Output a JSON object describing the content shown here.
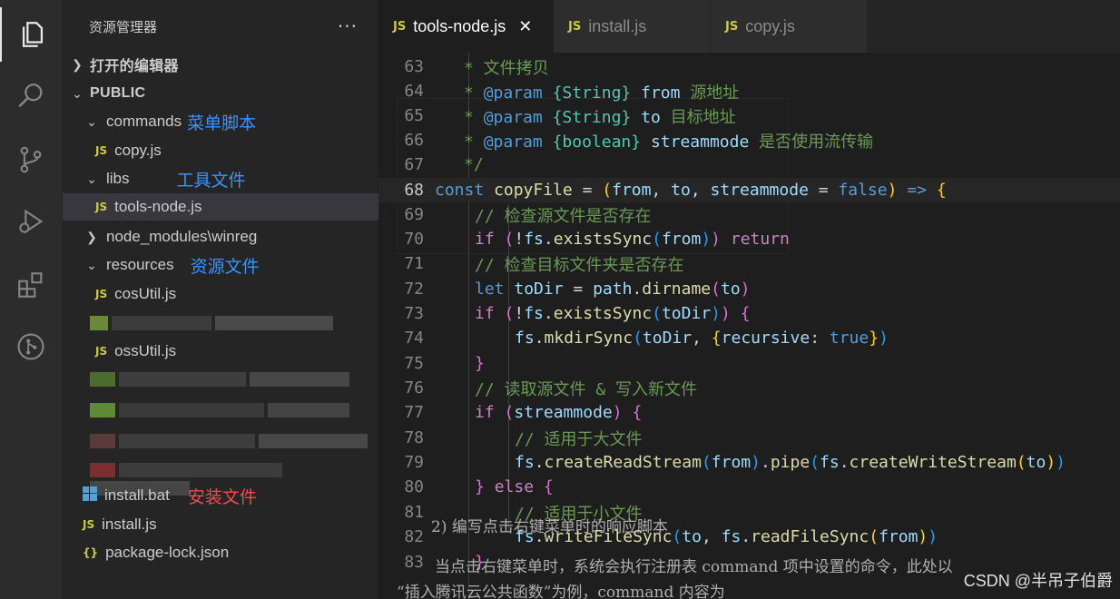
{
  "sidebar": {
    "title": "资源管理器",
    "more": "···",
    "open_editors": "打开的编辑器",
    "root": "PUBLIC",
    "items": [
      {
        "label": "commands",
        "note": "菜单脚本"
      },
      {
        "label": "copy.js"
      },
      {
        "label": "libs",
        "note": "工具文件"
      },
      {
        "label": "tools-node.js"
      },
      {
        "label": "node_modules\\winreg"
      },
      {
        "label": "resources",
        "note": "资源文件"
      },
      {
        "label": "cosUtil.js"
      },
      {
        "label": "ossUtil.js"
      },
      {
        "label": "install.bat",
        "note": "安装文件"
      },
      {
        "label": "install.js"
      },
      {
        "label": "package-lock.json"
      }
    ],
    "js_badge": "JS",
    "json_badge": "{}"
  },
  "tabs": [
    {
      "label": "tools-node.js",
      "close": "✕"
    },
    {
      "label": "install.js"
    },
    {
      "label": "copy.js"
    }
  ],
  "code": {
    "lines": [
      63,
      64,
      65,
      66,
      67,
      68,
      69,
      70,
      71,
      72,
      73,
      74,
      75,
      76,
      77,
      78,
      79,
      80,
      81,
      82,
      83
    ],
    "l63": "* 文件拷贝",
    "l64_param": "@param",
    "l64_type": "{String}",
    "l64_name": "from",
    "l64_desc": "源地址",
    "l65_param": "@param",
    "l65_type": "{String}",
    "l65_name": "to",
    "l65_desc": "目标地址",
    "l66_param": "@param",
    "l66_type": "{boolean}",
    "l66_name": "streammode",
    "l66_desc": "是否使用流传输",
    "l67": "*/",
    "l69": "// 检查源文件是否存在",
    "l71": "// 检查目标文件夹是否存在",
    "l76": "// 读取源文件 & 写入新文件",
    "l78": "// 适用于大文件",
    "l81": "// 适用于小文件"
  },
  "overlay": {
    "line1": "2) 编写点击右键菜单时的响应脚本",
    "line2": "当点击右键菜单时，系统会执行注册表 command 项中设置的命令，此处以",
    "line3": "“插入腾讯云公共函数”为例，command 内容为"
  },
  "watermark": "CSDN @半吊子伯爵"
}
